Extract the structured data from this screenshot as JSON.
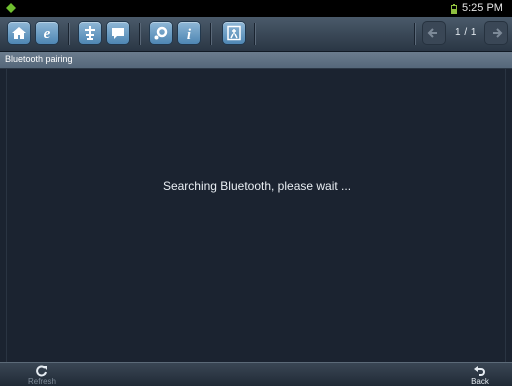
{
  "statusbar": {
    "time": "5:25 PM"
  },
  "toolbar": {
    "buttons": [
      "home-icon",
      "browser-icon",
      "diagnosis-icon",
      "chat-icon",
      "settings-icon",
      "info-icon",
      "exit-icon"
    ],
    "page_indicator": "1 / 1"
  },
  "titlebar": {
    "title": "Bluetooth pairing"
  },
  "content": {
    "message": "Searching Bluetooth, please wait ..."
  },
  "bottombar": {
    "refresh_label": "Refresh",
    "back_label": "Back"
  },
  "colors": {
    "background": "#1b2330",
    "accent": "#4e86b3",
    "text": "#e9eef3"
  }
}
